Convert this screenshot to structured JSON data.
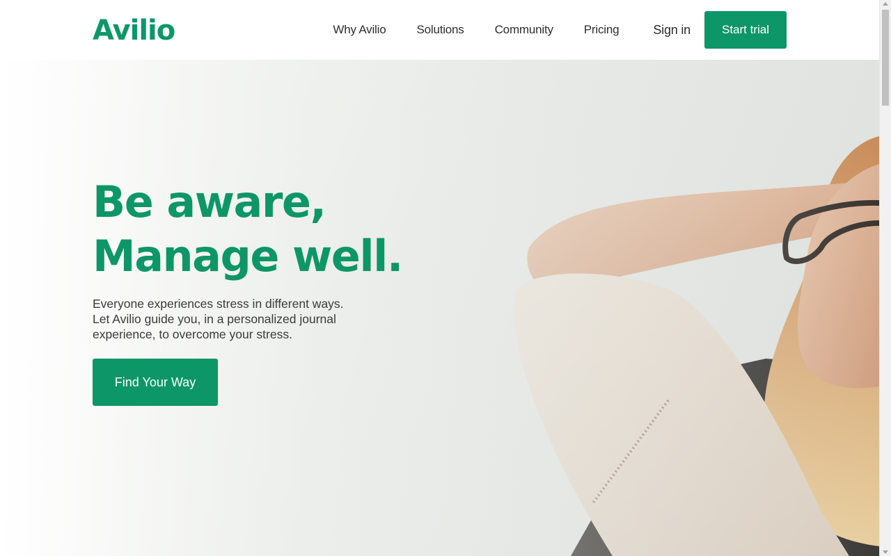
{
  "brand": {
    "logo_text": "Avilio",
    "accent_color": "#0d9668"
  },
  "nav": {
    "items": [
      {
        "label": "Why Avilio"
      },
      {
        "label": "Solutions"
      },
      {
        "label": "Community"
      },
      {
        "label": "Pricing"
      }
    ],
    "sign_in_label": "Sign in",
    "cta_label": "Start trial"
  },
  "hero": {
    "headline_line1": "Be aware,",
    "headline_line2": "Manage well.",
    "subtext": "Everyone experiences stress in different ways. Let Avilio guide you, in a personalized journal experience, to overcome your stress.",
    "cta_label": "Find Your Way",
    "image_subject": "woman-with-glasses-relaxing-photo"
  }
}
